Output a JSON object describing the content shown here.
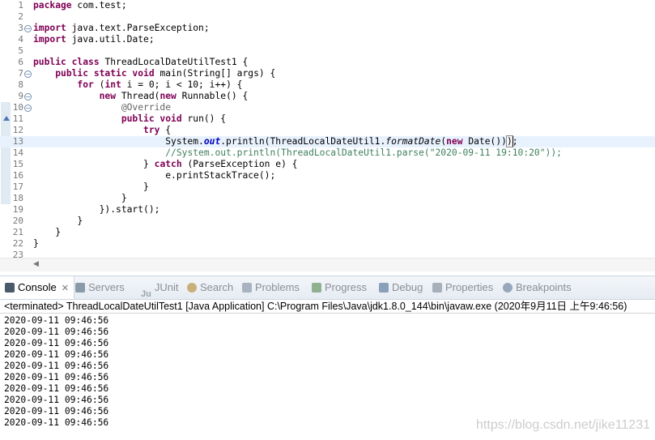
{
  "editor": {
    "lines": [
      {
        "n": "1",
        "tokens": [
          [
            "kw",
            "package"
          ],
          [
            "",
            "com.test;"
          ]
        ]
      },
      {
        "n": "2",
        "tokens": []
      },
      {
        "n": "3",
        "fold": "minus",
        "tokens": [
          [
            "kw",
            "import"
          ],
          [
            "",
            "java.text.ParseException;"
          ]
        ]
      },
      {
        "n": "4",
        "tokens": [
          [
            "kw",
            "import"
          ],
          [
            "",
            "java.util.Date;"
          ]
        ]
      },
      {
        "n": "5",
        "tokens": []
      },
      {
        "n": "6",
        "tokens": [
          [
            "kw",
            "public class"
          ],
          [
            "",
            "ThreadLocalDateUtilTest1 {"
          ]
        ]
      },
      {
        "n": "7",
        "fold": "minus",
        "tokens": [
          [
            "",
            "    "
          ],
          [
            "kw",
            "public static void"
          ],
          [
            "",
            "main(String[] args) {"
          ]
        ]
      },
      {
        "n": "8",
        "tokens": [
          [
            "",
            "        "
          ],
          [
            "kw",
            "for"
          ],
          [
            "",
            " ("
          ],
          [
            "kw",
            "int"
          ],
          [
            "",
            " i = 0; i < 10; i++) {"
          ]
        ]
      },
      {
        "n": "9",
        "fold": "minus",
        "tokens": [
          [
            "",
            "            "
          ],
          [
            "kw",
            "new"
          ],
          [
            "",
            " Thread("
          ],
          [
            "kw",
            "new"
          ],
          [
            "",
            "Runnable() {"
          ]
        ]
      },
      {
        "n": "10",
        "fold": "minus",
        "tokens": [
          [
            "",
            "                "
          ],
          [
            "ann",
            "@Override"
          ]
        ]
      },
      {
        "n": "11",
        "override": true,
        "tokens": [
          [
            "",
            "                "
          ],
          [
            "kw",
            "public void"
          ],
          [
            "",
            "run() {"
          ]
        ]
      },
      {
        "n": "12",
        "tokens": [
          [
            "",
            "                    "
          ],
          [
            "kw",
            "try"
          ],
          [
            "",
            " {"
          ]
        ]
      },
      {
        "n": "13",
        "current": true,
        "tokens": [
          [
            "",
            "                        System."
          ],
          [
            "fld",
            "out"
          ],
          [
            "",
            ".println(ThreadLocalDateUtil1."
          ],
          [
            "mth",
            "formatDate"
          ],
          [
            "",
            "("
          ],
          [
            "kw",
            "new"
          ],
          [
            "",
            " Date())"
          ],
          [
            "br",
            ")"
          ],
          [
            "",
            ";"
          ]
        ]
      },
      {
        "n": "14",
        "tokens": [
          [
            "",
            "                        "
          ],
          [
            "cmt",
            "//System.out.println(ThreadLocalDateUtil1.parse(\"2020-09-11 19:10:20\"));"
          ]
        ]
      },
      {
        "n": "15",
        "tokens": [
          [
            "",
            "                    } "
          ],
          [
            "kw",
            "catch"
          ],
          [
            "",
            " (ParseException e) {"
          ]
        ]
      },
      {
        "n": "16",
        "tokens": [
          [
            "",
            "                        e.printStackTrace();"
          ]
        ]
      },
      {
        "n": "17",
        "tokens": [
          [
            "",
            "                    }"
          ]
        ]
      },
      {
        "n": "18",
        "tokens": [
          [
            "",
            "                }"
          ]
        ]
      },
      {
        "n": "19",
        "tokens": [
          [
            "",
            "            }).start();"
          ]
        ]
      },
      {
        "n": "20",
        "tokens": [
          [
            "",
            "        }"
          ]
        ]
      },
      {
        "n": "21",
        "tokens": [
          [
            "",
            "    }"
          ]
        ]
      },
      {
        "n": "22",
        "tokens": [
          [
            "",
            "}"
          ]
        ]
      },
      {
        "n": "23",
        "tokens": []
      }
    ]
  },
  "views": {
    "tabs": [
      {
        "label": "Console",
        "icon": "console-icon",
        "active": true,
        "closable": true
      },
      {
        "label": "Servers",
        "icon": "servers-icon"
      },
      {
        "label": "JUnit",
        "icon": "junit-icon",
        "icon_text": "Ju"
      },
      {
        "label": "Search",
        "icon": "search-icon"
      },
      {
        "label": "Problems",
        "icon": "problems-icon"
      },
      {
        "label": "Progress",
        "icon": "progress-icon"
      },
      {
        "label": "Debug",
        "icon": "debug-icon"
      },
      {
        "label": "Properties",
        "icon": "properties-icon"
      },
      {
        "label": "Breakpoints",
        "icon": "breakpoints-icon"
      }
    ],
    "close_glyph": "✕"
  },
  "console": {
    "header": "<terminated> ThreadLocalDateUtilTest1 [Java Application] C:\\Program Files\\Java\\jdk1.8.0_144\\bin\\javaw.exe (2020年9月11日 上午9:46:56)",
    "output": [
      "2020-09-11 09:46:56",
      "2020-09-11 09:46:56",
      "2020-09-11 09:46:56",
      "2020-09-11 09:46:56",
      "2020-09-11 09:46:56",
      "2020-09-11 09:46:56",
      "2020-09-11 09:46:56",
      "2020-09-11 09:46:56",
      "2020-09-11 09:46:56",
      "2020-09-11 09:46:56"
    ]
  },
  "watermark": "https://blog.csdn.net/jike11231",
  "colors": {
    "keyword": "#7f0055",
    "comment": "#3f7f5f",
    "annotation": "#646464",
    "field": "#0000c0",
    "current_line": "#e8f2fe"
  }
}
